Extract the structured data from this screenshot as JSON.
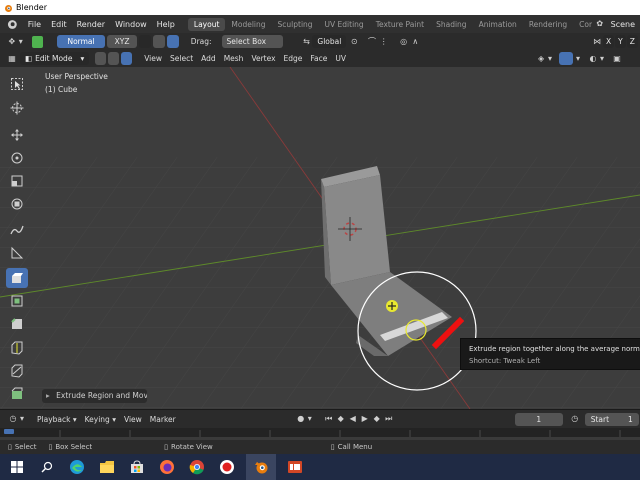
{
  "app": {
    "title": "Blender"
  },
  "menu": [
    "File",
    "Edit",
    "Render",
    "Window",
    "Help"
  ],
  "workspaces": [
    "Layout",
    "Modeling",
    "Sculpting",
    "UV Editing",
    "Texture Paint",
    "Shading",
    "Animation",
    "Rendering",
    "Compo"
  ],
  "scene_label": "Scene",
  "header2": {
    "mode_normal": "Normal",
    "mode_xyz": "XYZ",
    "drag_label": "Drag:",
    "select_box": "Select Box",
    "orientation": "Global",
    "axes": [
      "X",
      "Y",
      "Z"
    ]
  },
  "header3": {
    "edit_mode": "Edit Mode",
    "items": [
      "View",
      "Select",
      "Add",
      "Mesh",
      "Vertex",
      "Edge",
      "Face",
      "UV"
    ]
  },
  "viewport": {
    "perspective": "User Perspective",
    "object": "(1) Cube"
  },
  "tooltip": {
    "description": "Extrude region together along the average normal",
    "shortcut": "Shortcut: Tweak Left"
  },
  "last_operator": "Extrude Region and Move",
  "timeline": {
    "playback": "Playback",
    "keying": "Keying",
    "view": "View",
    "marker": "Marker",
    "current_frame": "1",
    "start_label": "Start",
    "start_value": "1"
  },
  "statusbar": {
    "select": "Select",
    "box_select": "Box Select",
    "rotate_view": "Rotate View",
    "call_menu": "Call Menu"
  },
  "colors": {
    "accent": "#4772b3",
    "x_axis": "#b03838",
    "y_axis": "#6b9a2a"
  }
}
